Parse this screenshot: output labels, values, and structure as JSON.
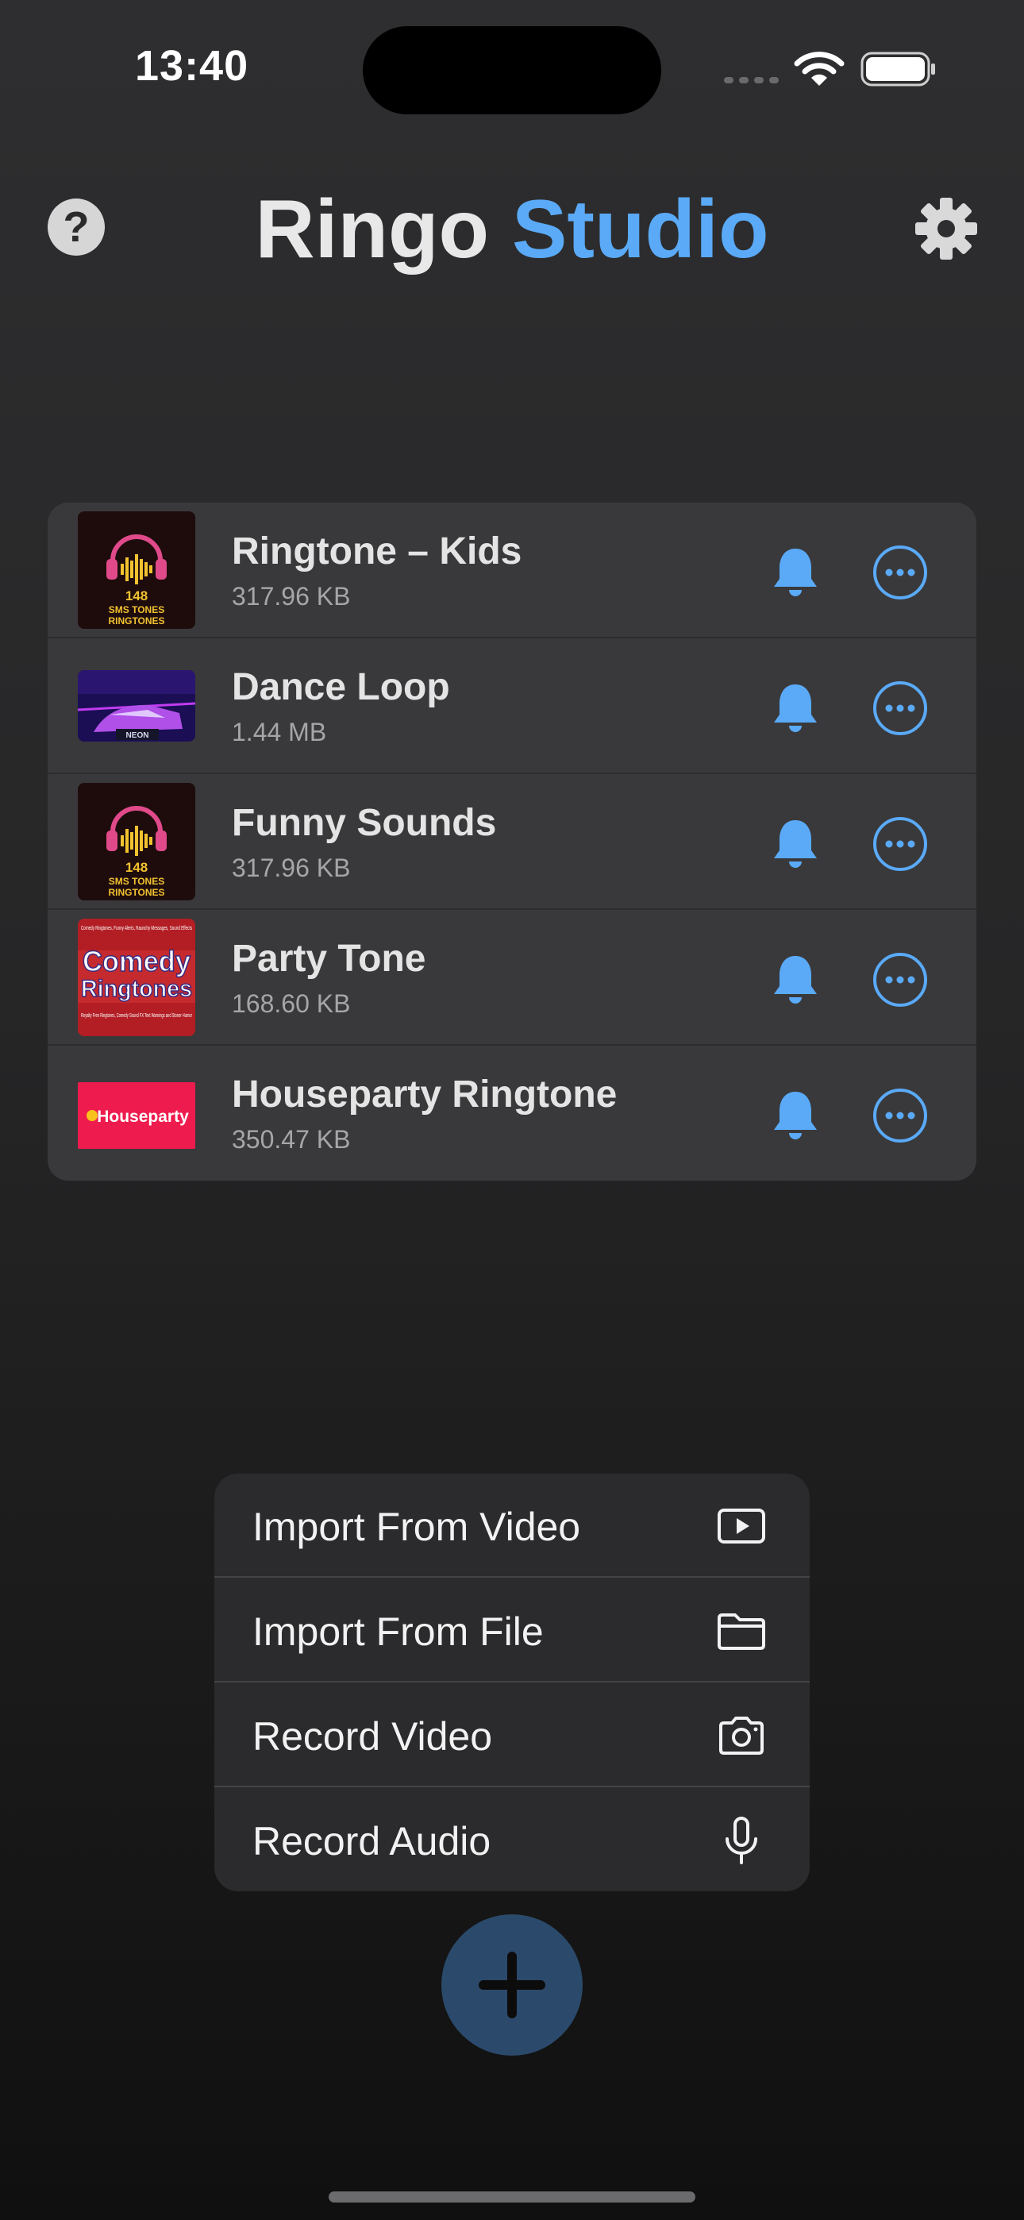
{
  "status_bar": {
    "time": "13:40"
  },
  "header": {
    "title_part1": "Ringo",
    "title_part2": "Studio",
    "help_label": "?"
  },
  "tracks": [
    {
      "title": "Ringtone – Kids",
      "size": "317.96 KB",
      "thumb": "sms-tones"
    },
    {
      "title": "Dance Loop",
      "size": "1.44 MB",
      "thumb": "neon-car"
    },
    {
      "title": "Funny Sounds",
      "size": "317.96 KB",
      "thumb": "sms-tones"
    },
    {
      "title": "Party Tone",
      "size": "168.60 KB",
      "thumb": "comedy-ringtones"
    },
    {
      "title": "Houseparty Ringtone",
      "size": "350.47 KB",
      "thumb": "houseparty"
    }
  ],
  "thumb_text": {
    "sms_line1": "148",
    "sms_line2": "SMS TONES",
    "sms_line3": "RINGTONES",
    "neon": "NEON",
    "comedy_top": "Comedy Ringtones, Funny Alerts, Raunchy Messages, Sound Effects",
    "comedy_big1": "Comedy",
    "comedy_big2": "Ringtones",
    "comedy_bottom": "Royalty Free Ringtones, Comedy Sound FX Text Warnings and Stoner Humor",
    "houseparty": "Houseparty"
  },
  "menu": {
    "items": [
      {
        "label": "Import From Video",
        "icon": "play-rectangle-icon"
      },
      {
        "label": "Import From File",
        "icon": "folder-icon"
      },
      {
        "label": "Record Video",
        "icon": "camera-icon"
      },
      {
        "label": "Record Audio",
        "icon": "microphone-icon"
      }
    ]
  },
  "colors": {
    "accent": "#5aaaf8",
    "background": "#262627",
    "card": "#39393b",
    "fab": "#2b4a6b"
  }
}
